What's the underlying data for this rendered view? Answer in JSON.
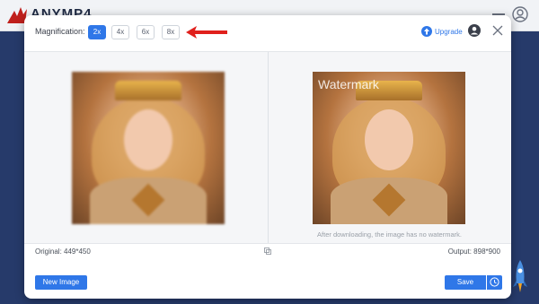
{
  "app": {
    "name": "ANYMP4",
    "logo_icon": "phoenix-logo-icon",
    "menu_icon": "minimize-icon",
    "user_icon": "user-account-icon",
    "rocket_icon": "rocket-icon"
  },
  "dialog": {
    "magnification_label": "Magnification:",
    "magnification_options": [
      "2x",
      "4x",
      "6x",
      "8x"
    ],
    "selected_magnification": "2x",
    "upgrade_label": "Upgrade",
    "watermark_text": "Watermark",
    "watermark_note": "After downloading, the image has no watermark.",
    "original_size": "Original: 449*450",
    "output_size": "Output: 898*900",
    "new_image_label": "New Image",
    "save_label": "Save"
  },
  "colors": {
    "accent": "#2f77e8",
    "background_app": "#263a6a",
    "annotation_arrow": "#e0201c"
  }
}
